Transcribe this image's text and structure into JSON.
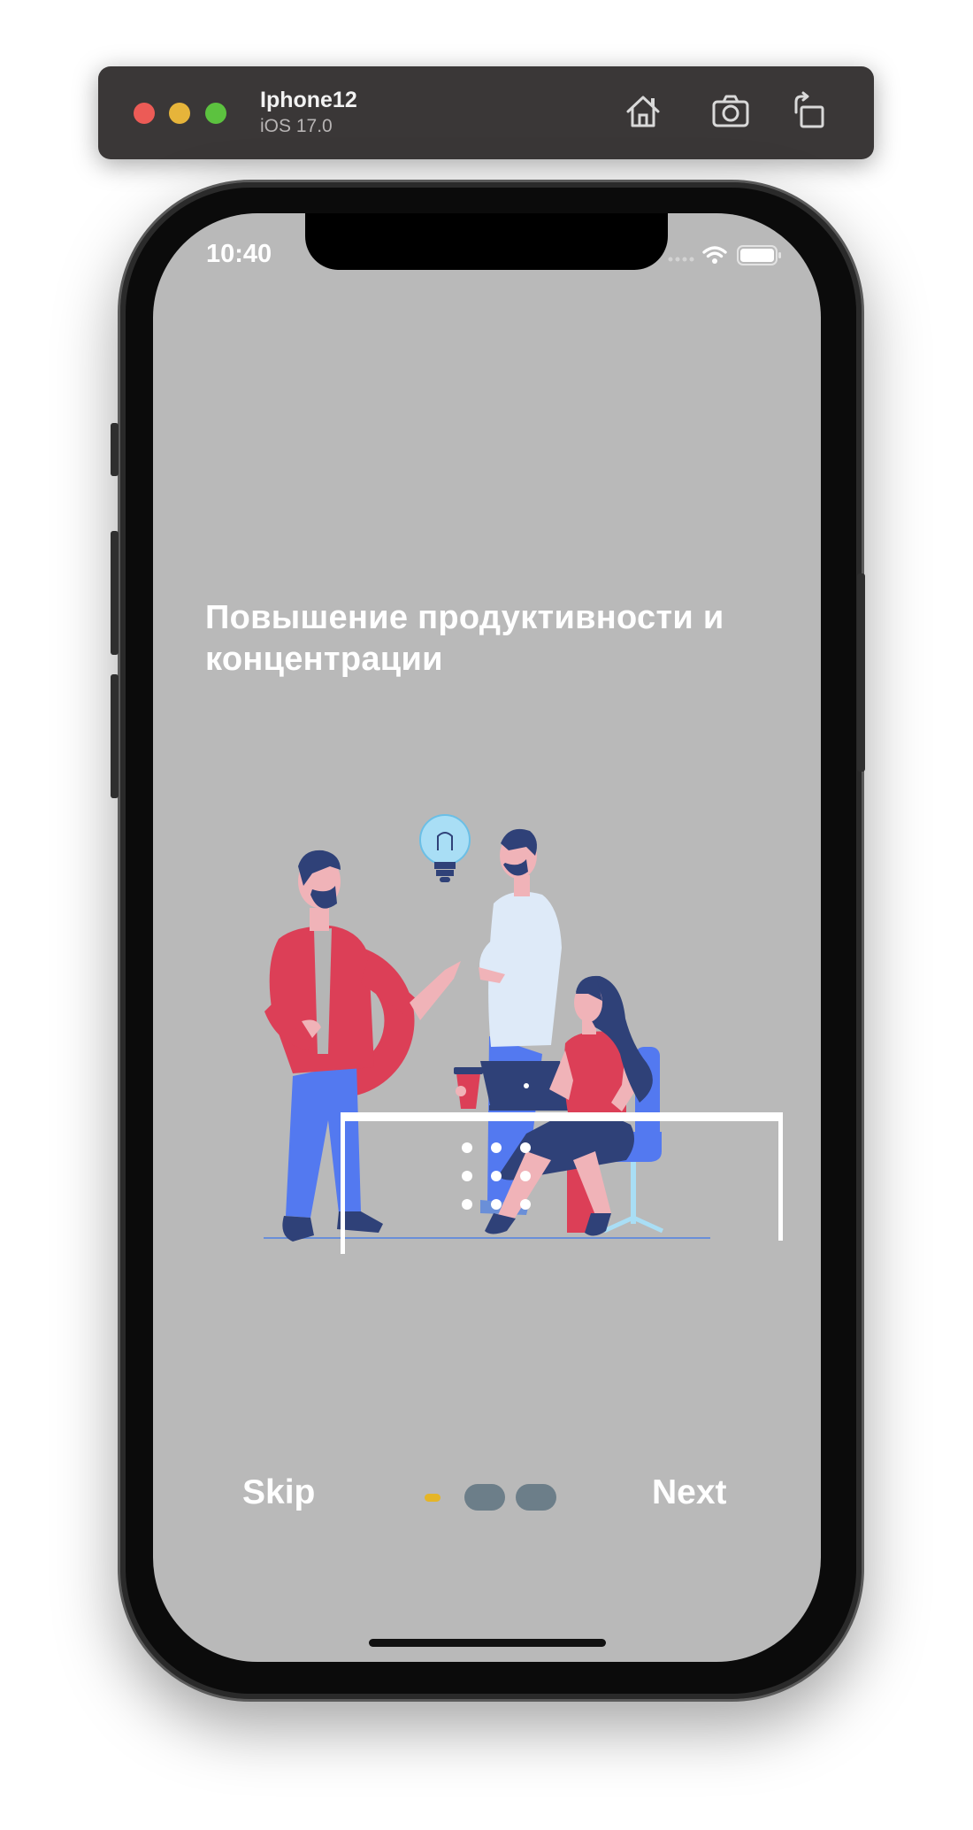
{
  "simulator": {
    "device_name": "Iphone12",
    "os_version": "iOS 17.0",
    "toolbar_icons": [
      "home-icon",
      "camera-icon",
      "rotate-icon"
    ]
  },
  "status_bar": {
    "time": "10:40",
    "icons": [
      "signal-icon",
      "wifi-icon",
      "battery-icon"
    ]
  },
  "onboarding": {
    "headline": "Повышение продуктивности и концентрации",
    "illustration": "team-collaboration-illustration",
    "skip_label": "Skip",
    "next_label": "Next",
    "page_count": 3,
    "current_page": 1
  },
  "colors": {
    "screen_bg": "#b9b9b9",
    "accent_red": "#dc3f57",
    "accent_blue": "#5379f0",
    "navy": "#2f4178",
    "active_dot": "#e5b527",
    "inactive_dot": "#6c7e89"
  }
}
